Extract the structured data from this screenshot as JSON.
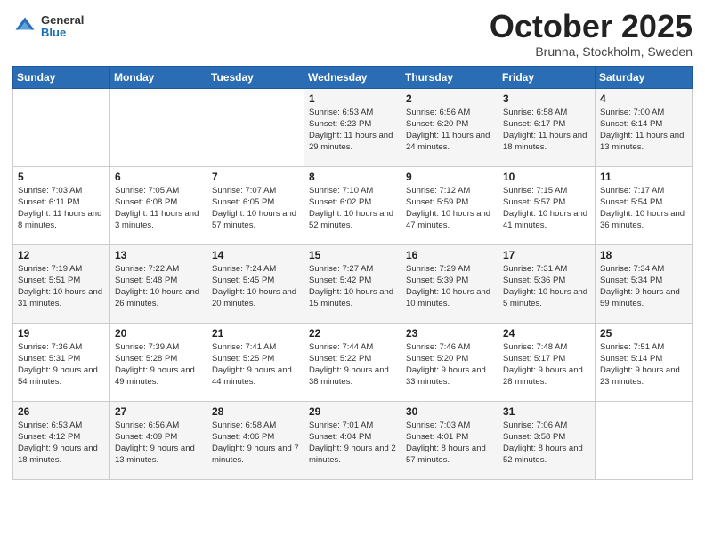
{
  "logo": {
    "general": "General",
    "blue": "Blue"
  },
  "title": "October 2025",
  "location": "Brunna, Stockholm, Sweden",
  "weekdays": [
    "Sunday",
    "Monday",
    "Tuesday",
    "Wednesday",
    "Thursday",
    "Friday",
    "Saturday"
  ],
  "weeks": [
    [
      {
        "day": "",
        "sunrise": "",
        "sunset": "",
        "daylight": ""
      },
      {
        "day": "",
        "sunrise": "",
        "sunset": "",
        "daylight": ""
      },
      {
        "day": "",
        "sunrise": "",
        "sunset": "",
        "daylight": ""
      },
      {
        "day": "1",
        "sunrise": "Sunrise: 6:53 AM",
        "sunset": "Sunset: 6:23 PM",
        "daylight": "Daylight: 11 hours and 29 minutes."
      },
      {
        "day": "2",
        "sunrise": "Sunrise: 6:56 AM",
        "sunset": "Sunset: 6:20 PM",
        "daylight": "Daylight: 11 hours and 24 minutes."
      },
      {
        "day": "3",
        "sunrise": "Sunrise: 6:58 AM",
        "sunset": "Sunset: 6:17 PM",
        "daylight": "Daylight: 11 hours and 18 minutes."
      },
      {
        "day": "4",
        "sunrise": "Sunrise: 7:00 AM",
        "sunset": "Sunset: 6:14 PM",
        "daylight": "Daylight: 11 hours and 13 minutes."
      }
    ],
    [
      {
        "day": "5",
        "sunrise": "Sunrise: 7:03 AM",
        "sunset": "Sunset: 6:11 PM",
        "daylight": "Daylight: 11 hours and 8 minutes."
      },
      {
        "day": "6",
        "sunrise": "Sunrise: 7:05 AM",
        "sunset": "Sunset: 6:08 PM",
        "daylight": "Daylight: 11 hours and 3 minutes."
      },
      {
        "day": "7",
        "sunrise": "Sunrise: 7:07 AM",
        "sunset": "Sunset: 6:05 PM",
        "daylight": "Daylight: 10 hours and 57 minutes."
      },
      {
        "day": "8",
        "sunrise": "Sunrise: 7:10 AM",
        "sunset": "Sunset: 6:02 PM",
        "daylight": "Daylight: 10 hours and 52 minutes."
      },
      {
        "day": "9",
        "sunrise": "Sunrise: 7:12 AM",
        "sunset": "Sunset: 5:59 PM",
        "daylight": "Daylight: 10 hours and 47 minutes."
      },
      {
        "day": "10",
        "sunrise": "Sunrise: 7:15 AM",
        "sunset": "Sunset: 5:57 PM",
        "daylight": "Daylight: 10 hours and 41 minutes."
      },
      {
        "day": "11",
        "sunrise": "Sunrise: 7:17 AM",
        "sunset": "Sunset: 5:54 PM",
        "daylight": "Daylight: 10 hours and 36 minutes."
      }
    ],
    [
      {
        "day": "12",
        "sunrise": "Sunrise: 7:19 AM",
        "sunset": "Sunset: 5:51 PM",
        "daylight": "Daylight: 10 hours and 31 minutes."
      },
      {
        "day": "13",
        "sunrise": "Sunrise: 7:22 AM",
        "sunset": "Sunset: 5:48 PM",
        "daylight": "Daylight: 10 hours and 26 minutes."
      },
      {
        "day": "14",
        "sunrise": "Sunrise: 7:24 AM",
        "sunset": "Sunset: 5:45 PM",
        "daylight": "Daylight: 10 hours and 20 minutes."
      },
      {
        "day": "15",
        "sunrise": "Sunrise: 7:27 AM",
        "sunset": "Sunset: 5:42 PM",
        "daylight": "Daylight: 10 hours and 15 minutes."
      },
      {
        "day": "16",
        "sunrise": "Sunrise: 7:29 AM",
        "sunset": "Sunset: 5:39 PM",
        "daylight": "Daylight: 10 hours and 10 minutes."
      },
      {
        "day": "17",
        "sunrise": "Sunrise: 7:31 AM",
        "sunset": "Sunset: 5:36 PM",
        "daylight": "Daylight: 10 hours and 5 minutes."
      },
      {
        "day": "18",
        "sunrise": "Sunrise: 7:34 AM",
        "sunset": "Sunset: 5:34 PM",
        "daylight": "Daylight: 9 hours and 59 minutes."
      }
    ],
    [
      {
        "day": "19",
        "sunrise": "Sunrise: 7:36 AM",
        "sunset": "Sunset: 5:31 PM",
        "daylight": "Daylight: 9 hours and 54 minutes."
      },
      {
        "day": "20",
        "sunrise": "Sunrise: 7:39 AM",
        "sunset": "Sunset: 5:28 PM",
        "daylight": "Daylight: 9 hours and 49 minutes."
      },
      {
        "day": "21",
        "sunrise": "Sunrise: 7:41 AM",
        "sunset": "Sunset: 5:25 PM",
        "daylight": "Daylight: 9 hours and 44 minutes."
      },
      {
        "day": "22",
        "sunrise": "Sunrise: 7:44 AM",
        "sunset": "Sunset: 5:22 PM",
        "daylight": "Daylight: 9 hours and 38 minutes."
      },
      {
        "day": "23",
        "sunrise": "Sunrise: 7:46 AM",
        "sunset": "Sunset: 5:20 PM",
        "daylight": "Daylight: 9 hours and 33 minutes."
      },
      {
        "day": "24",
        "sunrise": "Sunrise: 7:48 AM",
        "sunset": "Sunset: 5:17 PM",
        "daylight": "Daylight: 9 hours and 28 minutes."
      },
      {
        "day": "25",
        "sunrise": "Sunrise: 7:51 AM",
        "sunset": "Sunset: 5:14 PM",
        "daylight": "Daylight: 9 hours and 23 minutes."
      }
    ],
    [
      {
        "day": "26",
        "sunrise": "Sunrise: 6:53 AM",
        "sunset": "Sunset: 4:12 PM",
        "daylight": "Daylight: 9 hours and 18 minutes."
      },
      {
        "day": "27",
        "sunrise": "Sunrise: 6:56 AM",
        "sunset": "Sunset: 4:09 PM",
        "daylight": "Daylight: 9 hours and 13 minutes."
      },
      {
        "day": "28",
        "sunrise": "Sunrise: 6:58 AM",
        "sunset": "Sunset: 4:06 PM",
        "daylight": "Daylight: 9 hours and 7 minutes."
      },
      {
        "day": "29",
        "sunrise": "Sunrise: 7:01 AM",
        "sunset": "Sunset: 4:04 PM",
        "daylight": "Daylight: 9 hours and 2 minutes."
      },
      {
        "day": "30",
        "sunrise": "Sunrise: 7:03 AM",
        "sunset": "Sunset: 4:01 PM",
        "daylight": "Daylight: 8 hours and 57 minutes."
      },
      {
        "day": "31",
        "sunrise": "Sunrise: 7:06 AM",
        "sunset": "Sunset: 3:58 PM",
        "daylight": "Daylight: 8 hours and 52 minutes."
      },
      {
        "day": "",
        "sunrise": "",
        "sunset": "",
        "daylight": ""
      }
    ]
  ]
}
